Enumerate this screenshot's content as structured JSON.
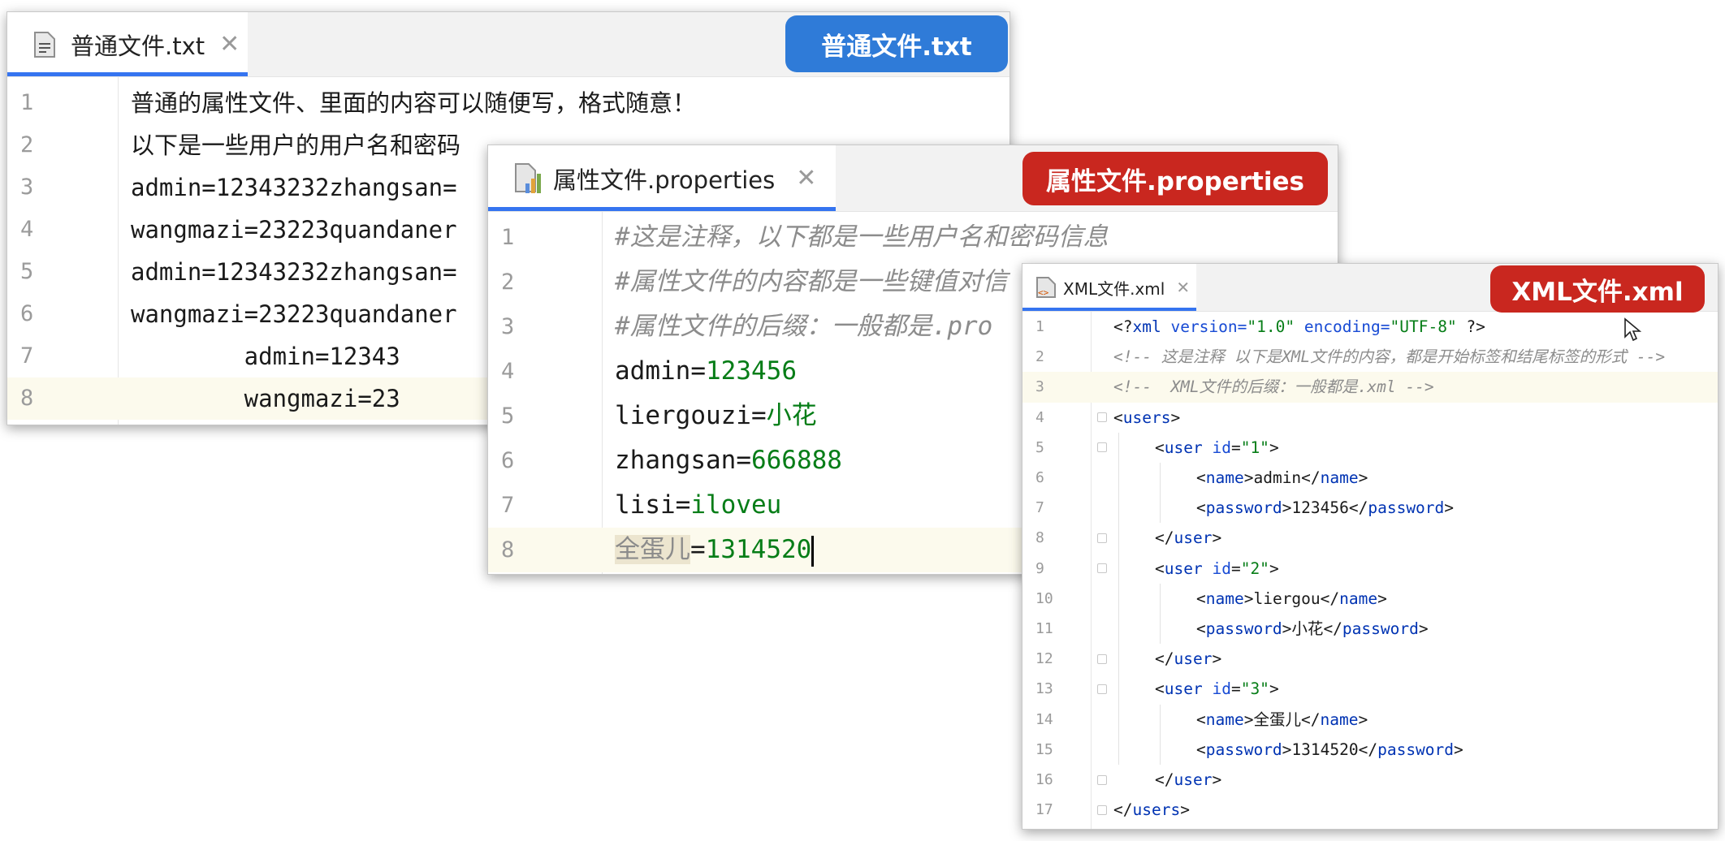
{
  "colors": {
    "blue_badge": "#2f7bd8",
    "red_badge": "#c9271f",
    "tab_underline": "#3574f0",
    "current_line": "#fcfaed"
  },
  "txt_window": {
    "tab_label": "普通文件.txt",
    "badge": "普通文件.txt",
    "icon": "text-file-icon",
    "line_numbers": [
      "1",
      "2",
      "3",
      "4",
      "5",
      "6",
      "7",
      "8"
    ],
    "lines": [
      "普通的属性文件、里面的内容可以随便写，格式随意！",
      "以下是一些用户的用户名和密码",
      "admin=12343232zhangsan=",
      "wangmazi=23223quandaner",
      "admin=12343232zhangsan=",
      "wangmazi=23223quandaner",
      "        admin=12343",
      "        wangmazi=23"
    ]
  },
  "props_window": {
    "tab_label": "属性文件.properties",
    "badge": "属性文件.properties",
    "icon": "properties-file-icon",
    "line_numbers": [
      "1",
      "2",
      "3",
      "4",
      "5",
      "6",
      "7",
      "8"
    ],
    "comments": [
      "#这是注释，以下都是一些用户名和密码信息",
      "#属性文件的内容都是一些键值对信",
      "#属性文件的后缀：一般都是.pro"
    ],
    "pairs": [
      {
        "key": "admin",
        "eq": "=",
        "value": "123456"
      },
      {
        "key": "liergouzi",
        "eq": "=",
        "value": "小花"
      },
      {
        "key": "zhangsan",
        "eq": "=",
        "value": "666888"
      },
      {
        "key": "lisi",
        "eq": "=",
        "value": "iloveu"
      },
      {
        "key": "全蛋儿",
        "eq": "=",
        "value": "1314520"
      }
    ]
  },
  "xml_window": {
    "tab_label": "XML文件.xml",
    "badge": "XML文件.xml",
    "icon": "xml-file-icon",
    "line_numbers": [
      "1",
      "2",
      "3",
      "4",
      "5",
      "6",
      "7",
      "8",
      "9",
      "10",
      "11",
      "12",
      "13",
      "14",
      "15",
      "16",
      "17"
    ],
    "decl": {
      "open": "<?",
      "name": "xml",
      "a1": " version=",
      "v1": "\"1.0\"",
      "a2": " encoding=",
      "v2": "\"UTF-8\"",
      "close": " ?>"
    },
    "comment1": "<!-- 这是注释 以下是XML文件的内容，都是开始标签和结尾标签的形式 -->",
    "comment2": "<!--  XML文件的后缀：一般都是.xml -->",
    "root_tag": "users",
    "user_tag": "user",
    "id_attr": "id",
    "name_tag": "name",
    "password_tag": "password",
    "users": [
      {
        "id": "\"1\"",
        "name": "admin",
        "password": "123456"
      },
      {
        "id": "\"2\"",
        "name": "liergou",
        "password": "小花"
      },
      {
        "id": "\"3\"",
        "name": "全蛋儿",
        "password": "1314520"
      }
    ]
  }
}
